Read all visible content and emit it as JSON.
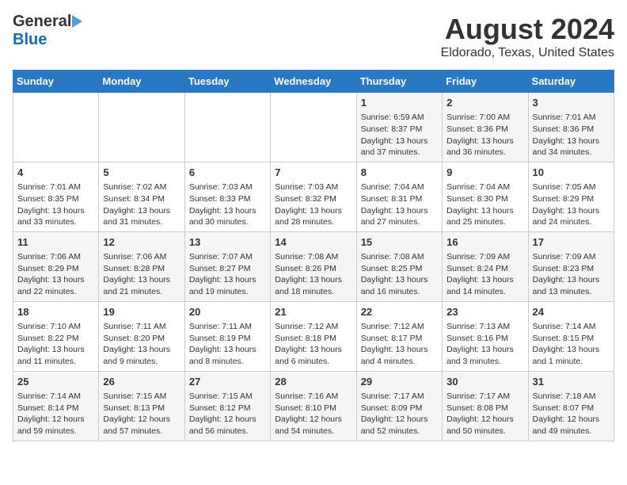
{
  "header": {
    "logo_general": "General",
    "logo_blue": "Blue",
    "title": "August 2024",
    "subtitle": "Eldorado, Texas, United States"
  },
  "calendar": {
    "days_of_week": [
      "Sunday",
      "Monday",
      "Tuesday",
      "Wednesday",
      "Thursday",
      "Friday",
      "Saturday"
    ],
    "weeks": [
      [
        {
          "day": "",
          "text": ""
        },
        {
          "day": "",
          "text": ""
        },
        {
          "day": "",
          "text": ""
        },
        {
          "day": "",
          "text": ""
        },
        {
          "day": "1",
          "text": "Sunrise: 6:59 AM\nSunset: 8:37 PM\nDaylight: 13 hours and 37 minutes."
        },
        {
          "day": "2",
          "text": "Sunrise: 7:00 AM\nSunset: 8:36 PM\nDaylight: 13 hours and 36 minutes."
        },
        {
          "day": "3",
          "text": "Sunrise: 7:01 AM\nSunset: 8:36 PM\nDaylight: 13 hours and 34 minutes."
        }
      ],
      [
        {
          "day": "4",
          "text": "Sunrise: 7:01 AM\nSunset: 8:35 PM\nDaylight: 13 hours and 33 minutes."
        },
        {
          "day": "5",
          "text": "Sunrise: 7:02 AM\nSunset: 8:34 PM\nDaylight: 13 hours and 31 minutes."
        },
        {
          "day": "6",
          "text": "Sunrise: 7:03 AM\nSunset: 8:33 PM\nDaylight: 13 hours and 30 minutes."
        },
        {
          "day": "7",
          "text": "Sunrise: 7:03 AM\nSunset: 8:32 PM\nDaylight: 13 hours and 28 minutes."
        },
        {
          "day": "8",
          "text": "Sunrise: 7:04 AM\nSunset: 8:31 PM\nDaylight: 13 hours and 27 minutes."
        },
        {
          "day": "9",
          "text": "Sunrise: 7:04 AM\nSunset: 8:30 PM\nDaylight: 13 hours and 25 minutes."
        },
        {
          "day": "10",
          "text": "Sunrise: 7:05 AM\nSunset: 8:29 PM\nDaylight: 13 hours and 24 minutes."
        }
      ],
      [
        {
          "day": "11",
          "text": "Sunrise: 7:06 AM\nSunset: 8:29 PM\nDaylight: 13 hours and 22 minutes."
        },
        {
          "day": "12",
          "text": "Sunrise: 7:06 AM\nSunset: 8:28 PM\nDaylight: 13 hours and 21 minutes."
        },
        {
          "day": "13",
          "text": "Sunrise: 7:07 AM\nSunset: 8:27 PM\nDaylight: 13 hours and 19 minutes."
        },
        {
          "day": "14",
          "text": "Sunrise: 7:08 AM\nSunset: 8:26 PM\nDaylight: 13 hours and 18 minutes."
        },
        {
          "day": "15",
          "text": "Sunrise: 7:08 AM\nSunset: 8:25 PM\nDaylight: 13 hours and 16 minutes."
        },
        {
          "day": "16",
          "text": "Sunrise: 7:09 AM\nSunset: 8:24 PM\nDaylight: 13 hours and 14 minutes."
        },
        {
          "day": "17",
          "text": "Sunrise: 7:09 AM\nSunset: 8:23 PM\nDaylight: 13 hours and 13 minutes."
        }
      ],
      [
        {
          "day": "18",
          "text": "Sunrise: 7:10 AM\nSunset: 8:22 PM\nDaylight: 13 hours and 11 minutes."
        },
        {
          "day": "19",
          "text": "Sunrise: 7:11 AM\nSunset: 8:20 PM\nDaylight: 13 hours and 9 minutes."
        },
        {
          "day": "20",
          "text": "Sunrise: 7:11 AM\nSunset: 8:19 PM\nDaylight: 13 hours and 8 minutes."
        },
        {
          "day": "21",
          "text": "Sunrise: 7:12 AM\nSunset: 8:18 PM\nDaylight: 13 hours and 6 minutes."
        },
        {
          "day": "22",
          "text": "Sunrise: 7:12 AM\nSunset: 8:17 PM\nDaylight: 13 hours and 4 minutes."
        },
        {
          "day": "23",
          "text": "Sunrise: 7:13 AM\nSunset: 8:16 PM\nDaylight: 13 hours and 3 minutes."
        },
        {
          "day": "24",
          "text": "Sunrise: 7:14 AM\nSunset: 8:15 PM\nDaylight: 13 hours and 1 minute."
        }
      ],
      [
        {
          "day": "25",
          "text": "Sunrise: 7:14 AM\nSunset: 8:14 PM\nDaylight: 12 hours and 59 minutes."
        },
        {
          "day": "26",
          "text": "Sunrise: 7:15 AM\nSunset: 8:13 PM\nDaylight: 12 hours and 57 minutes."
        },
        {
          "day": "27",
          "text": "Sunrise: 7:15 AM\nSunset: 8:12 PM\nDaylight: 12 hours and 56 minutes."
        },
        {
          "day": "28",
          "text": "Sunrise: 7:16 AM\nSunset: 8:10 PM\nDaylight: 12 hours and 54 minutes."
        },
        {
          "day": "29",
          "text": "Sunrise: 7:17 AM\nSunset: 8:09 PM\nDaylight: 12 hours and 52 minutes."
        },
        {
          "day": "30",
          "text": "Sunrise: 7:17 AM\nSunset: 8:08 PM\nDaylight: 12 hours and 50 minutes."
        },
        {
          "day": "31",
          "text": "Sunrise: 7:18 AM\nSunset: 8:07 PM\nDaylight: 12 hours and 49 minutes."
        }
      ]
    ]
  }
}
